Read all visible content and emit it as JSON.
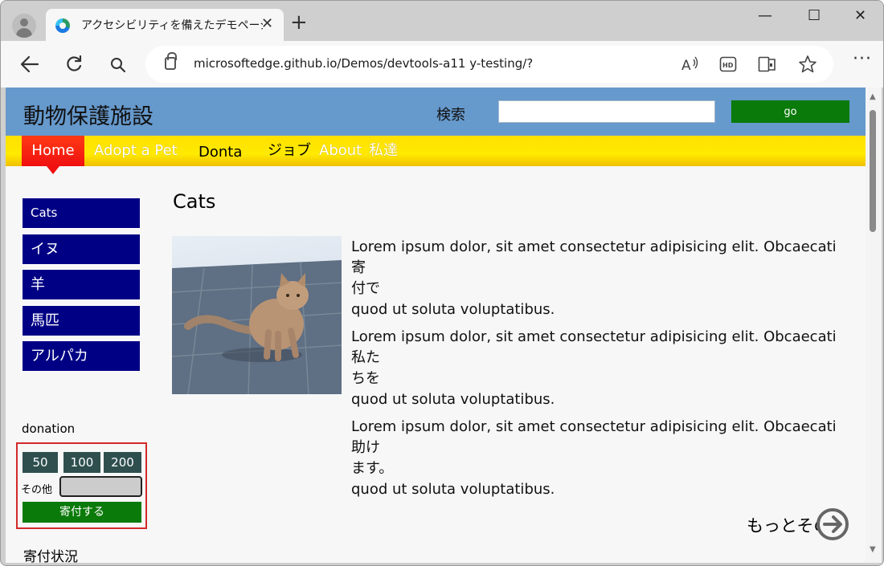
{
  "browser": {
    "tab_title": "アクセシビリティを備えたデモページは。",
    "tab_close": "✕",
    "new_tab": "+",
    "url": "microsoftedge.github.io/Demos/devtools-a11 y-testing/?",
    "window_controls": {
      "minimize": "—",
      "maximize": "☐",
      "close": "✕"
    }
  },
  "site": {
    "title": "動物保護施設",
    "search_label": "検索",
    "search_value": "",
    "go_label": "go"
  },
  "nav": {
    "home": "Home",
    "adopt": "Adopt a Pet",
    "donate": "Donta",
    "jobs": "ジョブ",
    "about": "About",
    "us": "私達"
  },
  "sidebar": {
    "items": [
      "Cats",
      "イヌ",
      "羊",
      "馬匹",
      "アルパカ"
    ]
  },
  "donation": {
    "label": "donation",
    "amounts": [
      "50",
      "100",
      "200"
    ],
    "other_label": "その他",
    "other_value": "",
    "submit_label": "寄付する",
    "status_label": "寄付状況"
  },
  "main": {
    "title": "Cats",
    "paragraphs": [
      [
        "Lorem ipsum dolor, sit amet consectetur adipisicing elit. Obcaecati",
        "寄",
        "付で",
        "quod ut soluta voluptatibus."
      ],
      [
        "Lorem ipsum dolor, sit amet consectetur adipisicing elit. Obcaecati",
        "私た",
        "ちを",
        "quod ut soluta voluptatibus."
      ],
      [
        "Lorem ipsum dolor, sit amet consectetur adipisicing elit. Obcaecati",
        "助け",
        "ます。",
        "quod ut soluta voluptatibus."
      ]
    ],
    "more_label": "もっとその"
  },
  "colors": {
    "header_blue": "#6699cc",
    "nav_yellow": "#ffe000",
    "home_red": "#f01010",
    "sidebar_navy": "#000085",
    "go_green": "#0a7a0a",
    "donation_border": "#d22a2a",
    "amount_slate": "#2f4f4f"
  },
  "icons": [
    "profile-icon",
    "edge-favicon",
    "back-icon",
    "refresh-icon",
    "search-icon",
    "lock-icon",
    "read-aloud-icon",
    "hd-icon",
    "immersive-reader-icon",
    "favorite-icon",
    "more-icon",
    "arrow-circle-right-icon"
  ]
}
